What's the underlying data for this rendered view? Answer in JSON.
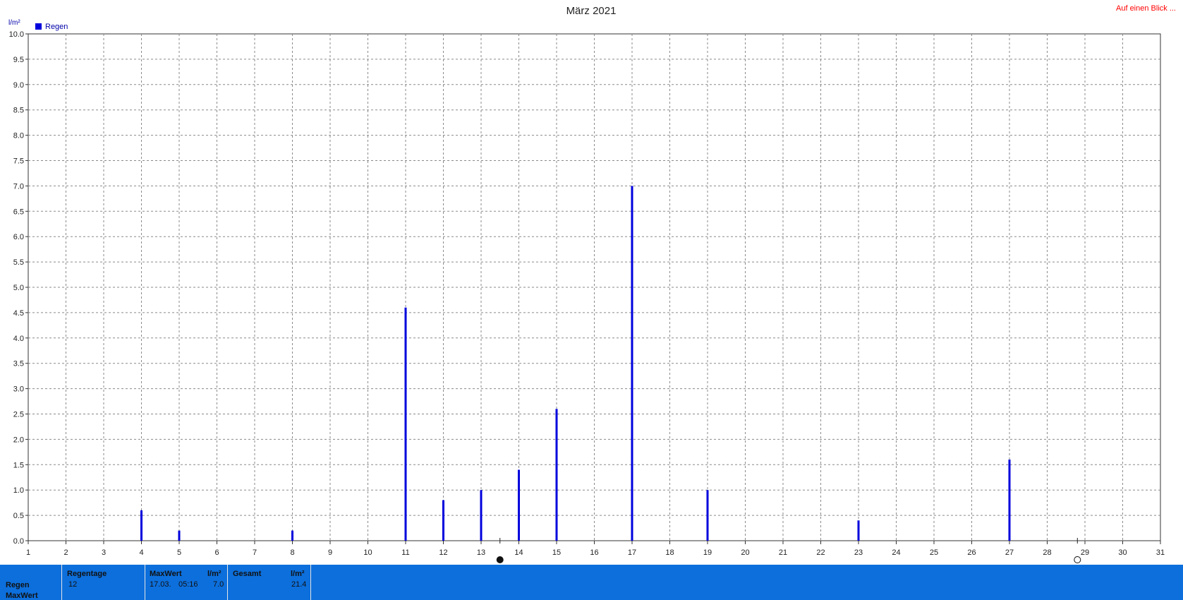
{
  "header": {
    "title": "März 2021",
    "overview_link": "Auf einen Blick ..."
  },
  "chart_data": {
    "type": "bar",
    "title": "März 2021",
    "ylabel": "l/m²",
    "xlabel": "",
    "ylim": [
      0,
      10
    ],
    "y_ticks": [
      "0.0",
      "0.5",
      "1.0",
      "1.5",
      "2.0",
      "2.5",
      "3.0",
      "3.5",
      "4.0",
      "4.5",
      "5.0",
      "5.5",
      "6.0",
      "6.5",
      "7.0",
      "7.5",
      "8.0",
      "8.5",
      "9.0",
      "9.5",
      "10.0"
    ],
    "x_ticks": [
      "1",
      "2",
      "3",
      "4",
      "5",
      "6",
      "7",
      "8",
      "9",
      "10",
      "11",
      "12",
      "13",
      "14",
      "15",
      "16",
      "17",
      "18",
      "19",
      "20",
      "21",
      "22",
      "23",
      "24",
      "25",
      "26",
      "27",
      "28",
      "29",
      "30",
      "31"
    ],
    "xlim": [
      1,
      31
    ],
    "grid": true,
    "legend_position": "top-left",
    "series": [
      {
        "name": "Regen",
        "color": "#0000dd",
        "x": [
          4,
          5,
          8,
          11,
          12,
          13,
          14,
          15,
          17,
          19,
          23,
          27
        ],
        "values": [
          0.6,
          0.2,
          0.2,
          4.6,
          0.8,
          1.0,
          1.4,
          2.6,
          7.0,
          1.0,
          0.4,
          1.6
        ]
      }
    ],
    "moon_phases": [
      {
        "type": "full-moon",
        "day": 13.5
      },
      {
        "type": "new-moon",
        "day": 28.8
      }
    ]
  },
  "summary": {
    "row_labels": [
      "Regen",
      "MaxWert"
    ],
    "regentage": {
      "header": "Regentage",
      "value": "12"
    },
    "maxwert": {
      "header": "MaxWert",
      "unit": "l/m²",
      "date": "17.03.",
      "time": "05:16",
      "value": "7.0"
    },
    "gesamt": {
      "header": "Gesamt",
      "unit": "l/m²",
      "value": "21.4"
    }
  }
}
